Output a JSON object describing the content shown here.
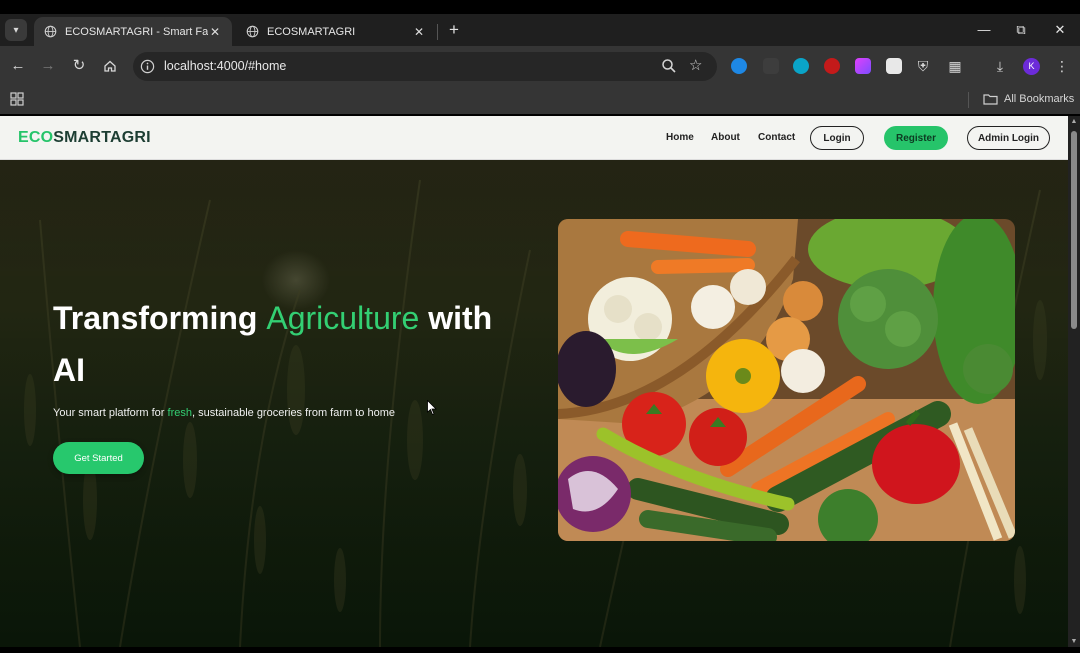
{
  "browser": {
    "tabs": [
      {
        "title": "ECOSMARTAGRI - Smart Farm-t",
        "active": true
      },
      {
        "title": "ECOSMARTAGRI",
        "active": false
      }
    ],
    "url": "localhost:4000/#home",
    "bookmarks_label": "All Bookmarks",
    "profile_initial": "K"
  },
  "site": {
    "logo": {
      "eco": "ECO",
      "rest": "SMARTAGRI"
    },
    "nav": {
      "home": "Home",
      "about": "About",
      "contact": "Contact",
      "login": "Login",
      "register": "Register",
      "admin_login": "Admin Login"
    },
    "hero": {
      "title_part1": "Transforming ",
      "title_accent": "Agriculture",
      "title_part2": " with AI",
      "subtitle_part1": "Your smart platform for ",
      "subtitle_accent": "fresh",
      "subtitle_part2": ", sustainable groceries from farm to home",
      "cta": "Get Started"
    }
  },
  "colors": {
    "accent": "#26c46a",
    "nav_bg": "#f3f4f1",
    "browser_dark": "#353535"
  }
}
